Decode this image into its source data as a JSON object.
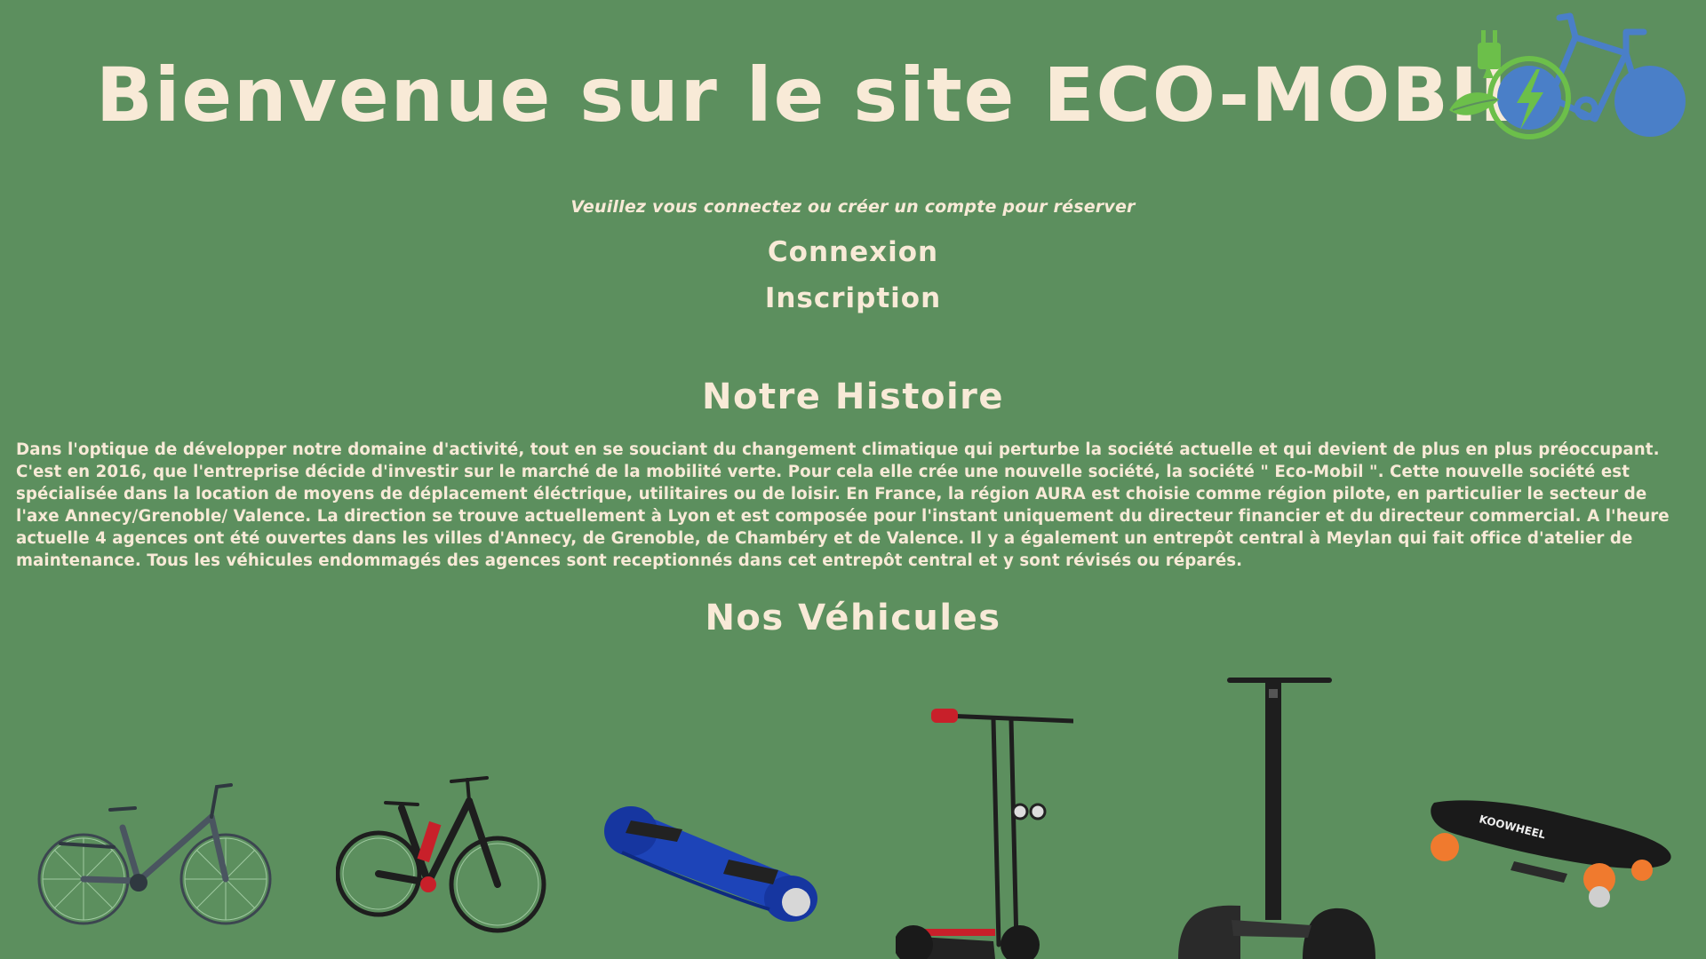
{
  "header": {
    "title": "Bienvenue sur le site ECO-MOBIL",
    "logo_icon": "eco-bike-charging-icon"
  },
  "auth": {
    "prompt": "Veuillez vous connectez ou créer un compte pour réserver",
    "login_label": "Connexion",
    "signup_label": "Inscription"
  },
  "history": {
    "title": "Notre Histoire",
    "text": "Dans l'optique de développer notre domaine d'activité, tout en se souciant du changement climatique qui perturbe la société actuelle et qui devient de plus en plus préoccupant. C'est en 2016, que l'entreprise décide d'investir sur le marché de la mobilité verte. Pour cela elle crée une nouvelle société, la société \" Eco-Mobil \". Cette nouvelle société est spécialisée dans la location de moyens de déplacement éléctrique, utilitaires ou de loisir. En France, la région AURA est choisie comme région pilote, en particulier le secteur de l'axe Annecy/Grenoble/ Valence. La direction se trouve actuellement à Lyon et est composée pour l'instant uniquement du directeur financier et du directeur commercial. A l'heure actuelle 4 agences ont été ouvertes dans les villes d'Annecy, de Grenoble, de Chambéry et de Valence. Il y a également un entrepôt central à Meylan qui fait office d'atelier de maintenance. Tous les véhicules endommagés des agences sont receptionnés dans cet entrepôt central et y sont révisés ou réparés."
  },
  "vehicles": {
    "title": "Nos Véhicules",
    "items": [
      {
        "icon": "city-ebike-icon"
      },
      {
        "icon": "mountain-ebike-icon"
      },
      {
        "icon": "hoverboard-icon"
      },
      {
        "icon": "electric-scooter-icon"
      },
      {
        "icon": "segway-icon"
      },
      {
        "icon": "electric-skateboard-icon",
        "brand": "KOOWHEEL"
      }
    ]
  },
  "colors": {
    "background": "#5c8f5e",
    "text": "#f8ead7",
    "logo_blue": "#4a7fc8",
    "logo_green": "#6cbf4a"
  }
}
